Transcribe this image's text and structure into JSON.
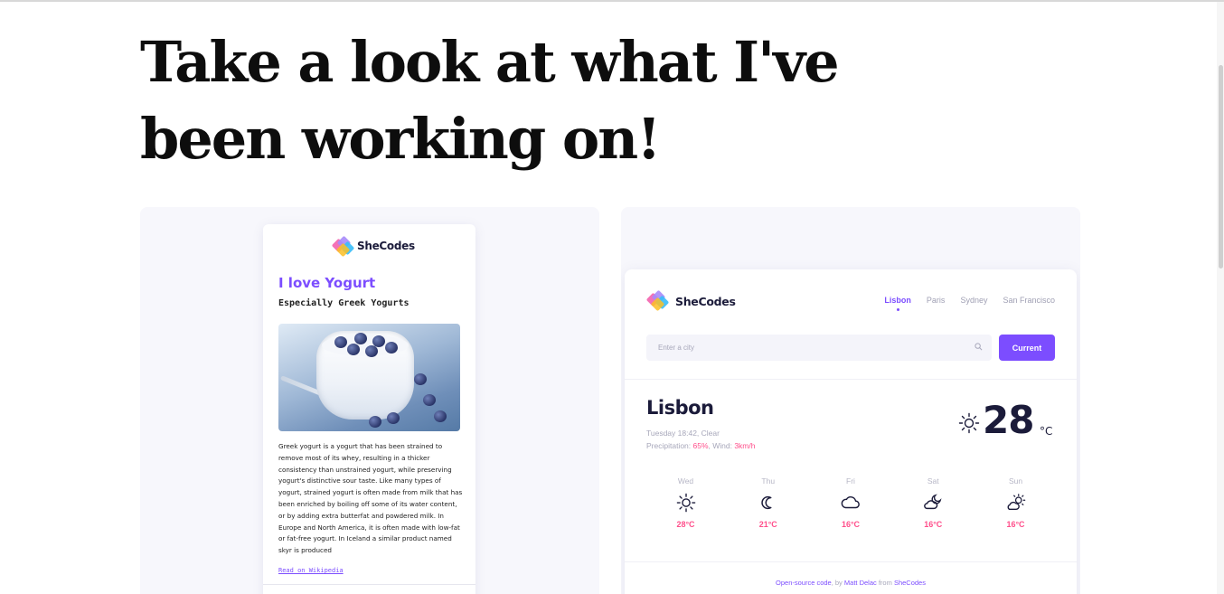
{
  "headline": "Take a look at what I've been working on!",
  "projects": {
    "yogurt": {
      "logo_text": "SheCodes",
      "title": "I love Yogurt",
      "subtitle": "Especially Greek Yogurts",
      "image_icon": "yogurt-photo",
      "body": "Greek yogurt is a yogurt that has been strained to remove most of its whey, resulting in a thicker consistency than unstrained yogurt, while preserving yogurt's distinctive sour taste. Like many types of yogurt, strained yogurt is often made from milk that has been enriched by boiling off some of its water content, or by adding extra butterfat and powdered milk. In Europe and North America, it is often made with low-fat or fat-free yogurt. In Iceland a similar product named skyr is produced",
      "link": "Read on Wikipedia"
    },
    "weather": {
      "logo_text": "SheCodes",
      "cities": [
        "Lisbon",
        "Paris",
        "Sydney",
        "San Francisco"
      ],
      "active_city": "Lisbon",
      "search_placeholder": "Enter a city",
      "current_button": "Current",
      "city": "Lisbon",
      "date_line": "Tuesday 18:42, Clear",
      "precip_label": "Precipitation: ",
      "precip_value": "65%",
      "wind_label": ", Wind: ",
      "wind_value": "3km/h",
      "temperature": "28",
      "unit": "°C",
      "current_icon": "sun-icon",
      "forecast": [
        {
          "day": "Wed",
          "temp": "28°C",
          "icon": "sun-icon"
        },
        {
          "day": "Thu",
          "temp": "21°C",
          "icon": "moon-icon"
        },
        {
          "day": "Fri",
          "temp": "16°C",
          "icon": "cloud-icon"
        },
        {
          "day": "Sat",
          "temp": "16°C",
          "icon": "cloud-moon-icon"
        },
        {
          "day": "Sun",
          "temp": "16°C",
          "icon": "cloud-sun-icon"
        }
      ],
      "footer": {
        "link1": "Open-source code",
        "text1": ", by ",
        "link2": "Matt Delac",
        "text2": " from ",
        "link3": "SheCodes"
      }
    }
  },
  "colors": {
    "accent": "#7c4dff",
    "highlight": "#ff4f8b",
    "card_bg": "#f7f7fc",
    "heading": "#0d0d0d"
  }
}
